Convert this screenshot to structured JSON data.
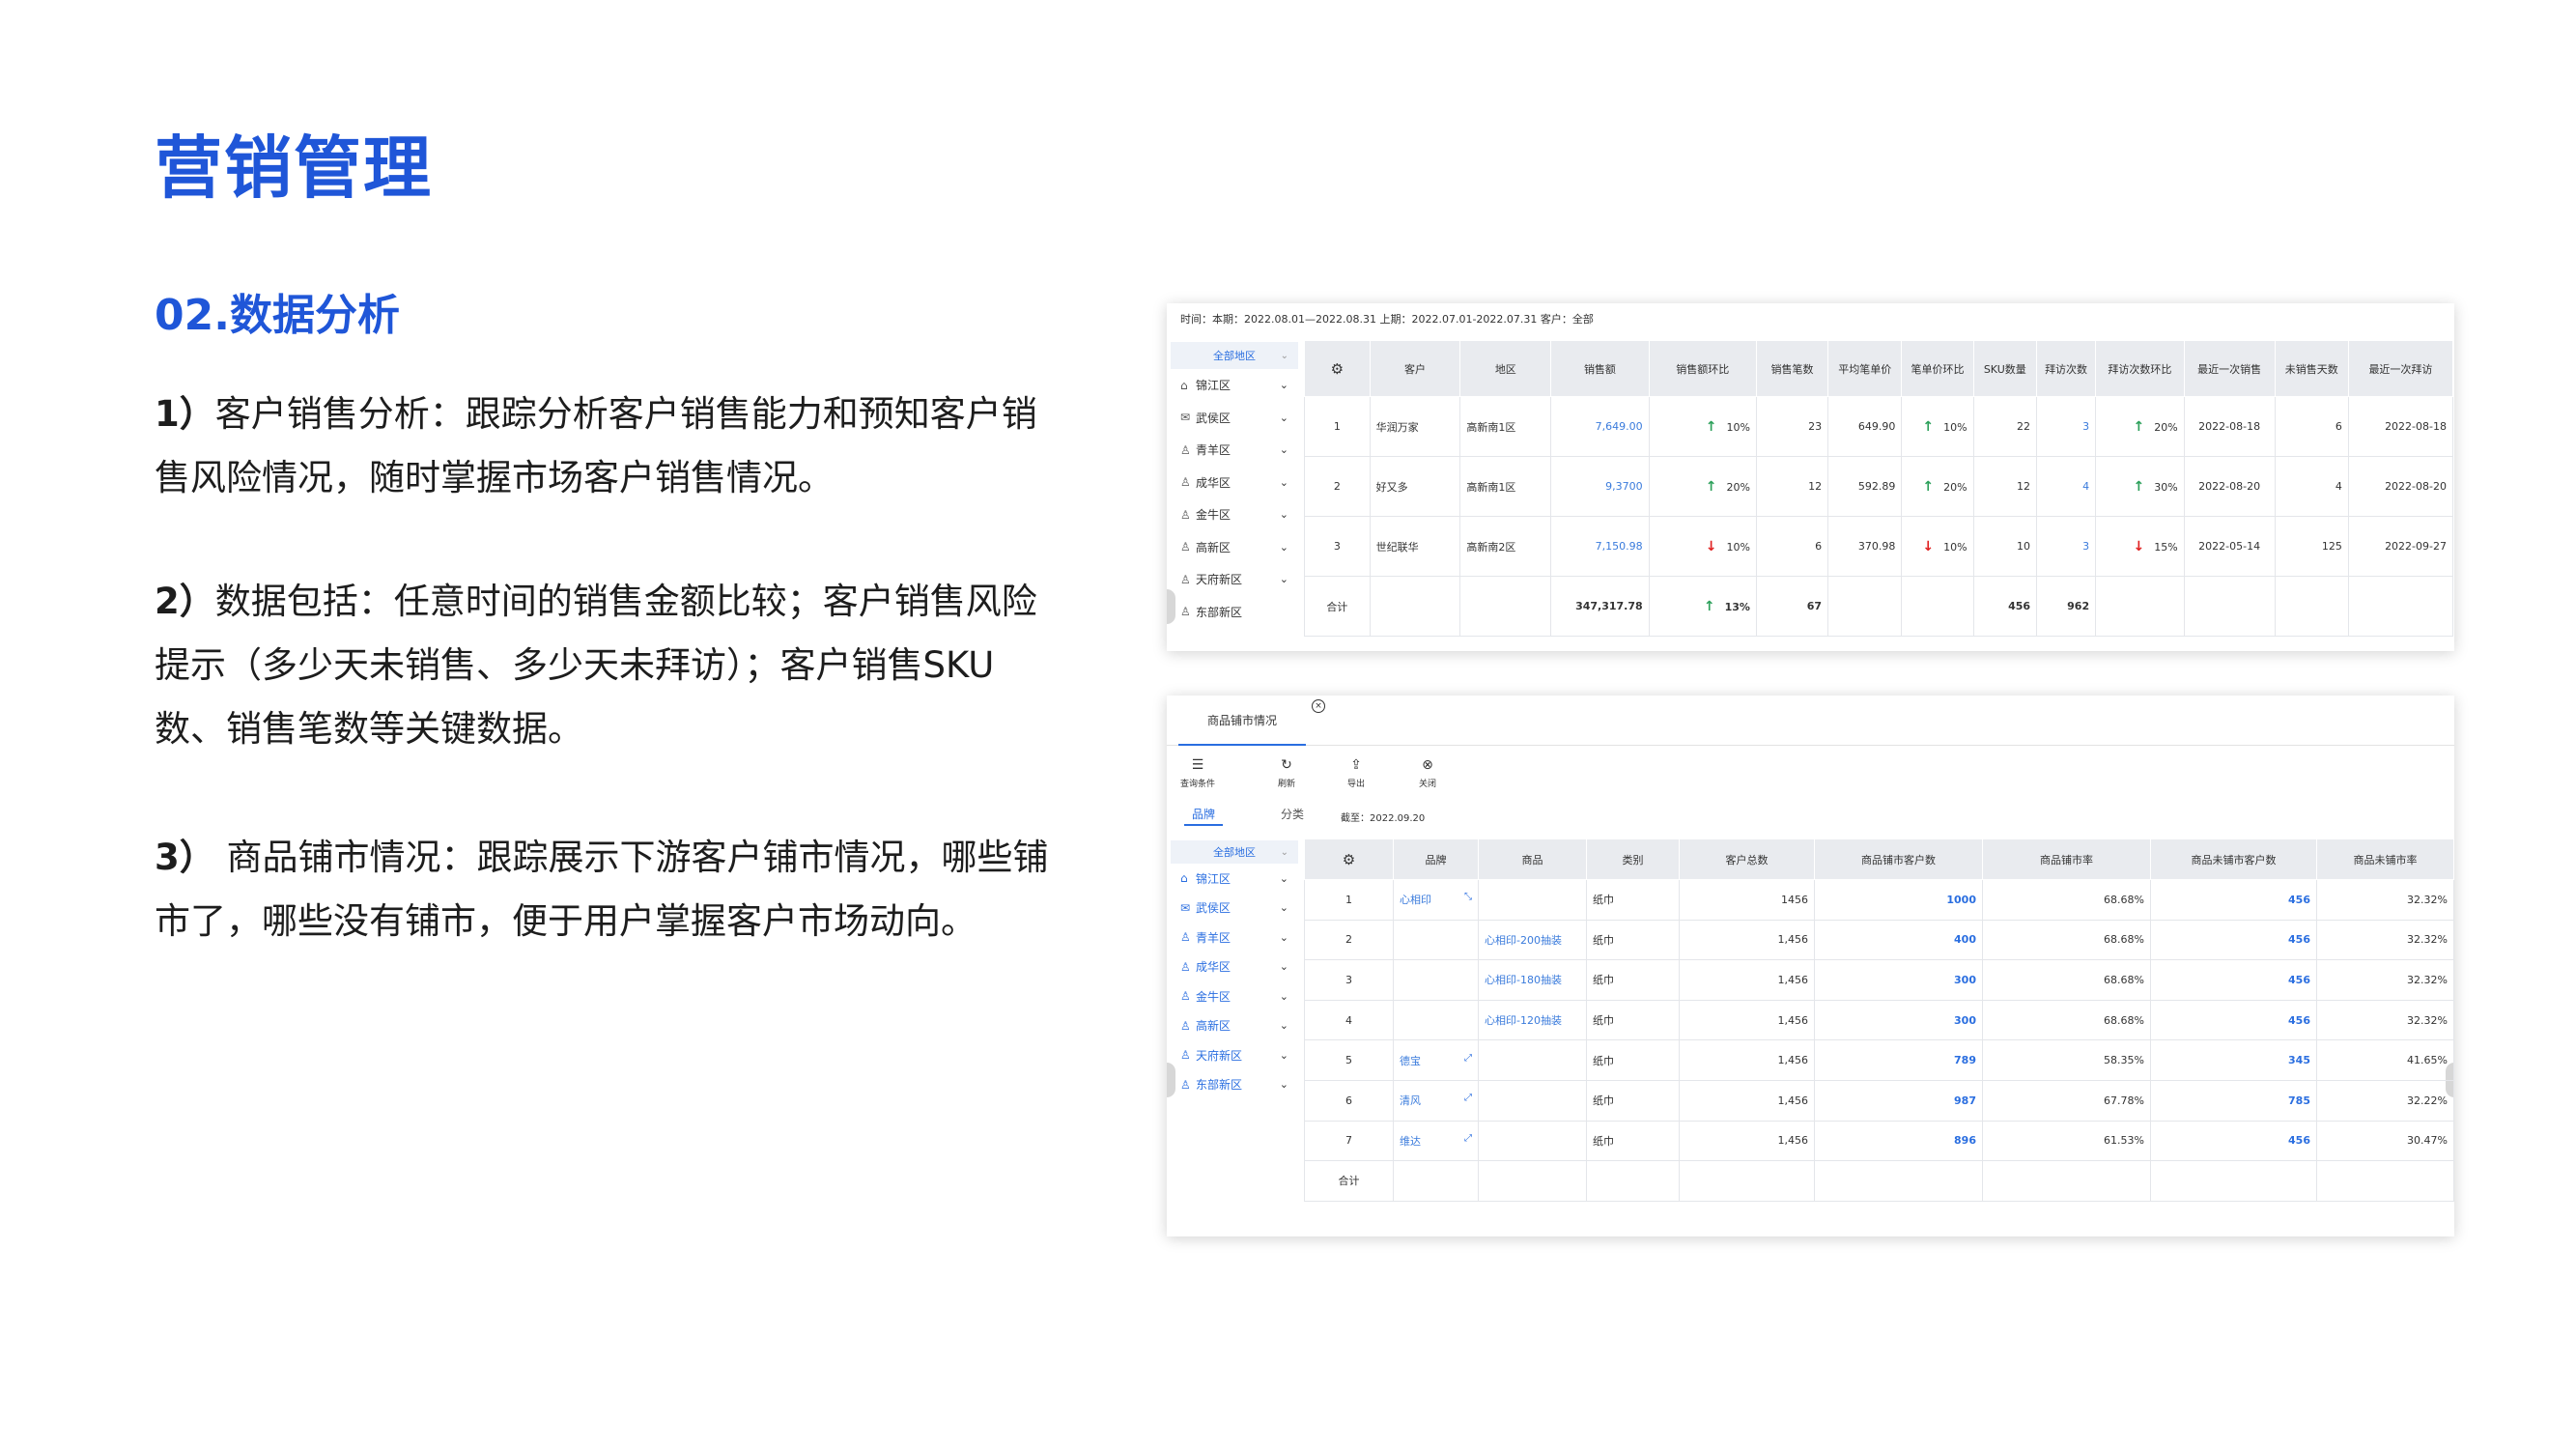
{
  "page": {
    "title": "营销管理",
    "subtitle": "02.数据分析",
    "paragraphs": [
      {
        "num": "1）",
        "text": "客户销售分析：跟踪分析客户销售能力和预知客户销售风险情况，随时掌握市场客户销售情况。"
      },
      {
        "num": "2）",
        "text": "数据包括：任意时间的销售金额比较；客户销售风险提示（多少天未销售、多少天未拜访）；客户销售SKU数、销售笔数等关键数据。"
      },
      {
        "num": "3）",
        "text": " 商品铺市情况：跟踪展示下游客户铺市情况，哪些铺市了，哪些没有铺市，便于用户掌握客户市场动向。"
      }
    ]
  },
  "panel1": {
    "header": "时间：本期：2022.08.01—2022.08.31  上期：2022.07.01-2022.07.31   客户：全部",
    "sidebar": {
      "selected": "全部地区",
      "items": [
        "锦江区",
        "武侯区",
        "青羊区",
        "成华区",
        "金牛区",
        "高新区",
        "天府新区",
        "东部新区"
      ]
    },
    "columns": [
      "客户",
      "地区",
      "销售额",
      "销售额环比",
      "销售笔数",
      "平均笔单价",
      "笔单价环比",
      "SKU数量",
      "拜访次数",
      "拜访次数环比",
      "最近一次销售",
      "未销售天数",
      "最近一次拜访"
    ],
    "rows": [
      {
        "no": "1",
        "customer": "华润万家",
        "region": "高新南1区",
        "sales": "7,649.00",
        "sales_ratio": "10%",
        "sales_dir": "up",
        "count": "23",
        "avg": "649.90",
        "avg_ratio": "10%",
        "avg_dir": "up",
        "sku": "22",
        "visits": "3",
        "visit_ratio": "20%",
        "visit_dir": "up",
        "last_sale": "2022-08-18",
        "unsold_days": "6",
        "last_visit": "2022-08-18"
      },
      {
        "no": "2",
        "customer": "好又多",
        "region": "高新南1区",
        "sales": "9,3700",
        "sales_ratio": "20%",
        "sales_dir": "up",
        "count": "12",
        "avg": "592.89",
        "avg_ratio": "20%",
        "avg_dir": "up",
        "sku": "12",
        "visits": "4",
        "visit_ratio": "30%",
        "visit_dir": "up",
        "last_sale": "2022-08-20",
        "unsold_days": "4",
        "last_visit": "2022-08-20"
      },
      {
        "no": "3",
        "customer": "世纪联华",
        "region": "高新南2区",
        "sales": "7,150.98",
        "sales_ratio": "10%",
        "sales_dir": "down",
        "count": "6",
        "avg": "370.98",
        "avg_ratio": "10%",
        "avg_dir": "down",
        "sku": "10",
        "visits": "3",
        "visit_ratio": "15%",
        "visit_dir": "down",
        "last_sale": "2022-05-14",
        "unsold_days": "125",
        "last_visit": "2022-09-27"
      }
    ],
    "total": {
      "label": "合计",
      "sales": "347,317.78",
      "sales_ratio": "13%",
      "count": "67",
      "sku": "456",
      "visits": "962"
    }
  },
  "panel2": {
    "tab_label": "商品铺市情况",
    "tools": [
      "查询条件",
      "刷新",
      "导出",
      "关闭"
    ],
    "subtabs": [
      "品牌",
      "分类"
    ],
    "cutoff": "截至：2022.09.20",
    "sidebar": {
      "selected": "全部地区",
      "items": [
        "锦江区",
        "武侯区",
        "青羊区",
        "成华区",
        "金牛区",
        "高新区",
        "天府新区",
        "东部新区"
      ]
    },
    "columns": [
      "品牌",
      "商品",
      "类别",
      "客户总数",
      "商品铺市客户数",
      "商品铺市率",
      "商品未铺市客户数",
      "商品未铺市率"
    ],
    "rows": [
      {
        "no": "1",
        "brand": "心相印",
        "product": "",
        "category": "纸巾",
        "total": "1456",
        "covered": "1000",
        "rate": "68.68%",
        "uncovered": "456",
        "unrate": "32.32%"
      },
      {
        "no": "2",
        "brand": "",
        "product": "心相印-200抽装",
        "category": "纸巾",
        "total": "1,456",
        "covered": "400",
        "rate": "68.68%",
        "uncovered": "456",
        "unrate": "32.32%"
      },
      {
        "no": "3",
        "brand": "",
        "product": "心相印-180抽装",
        "category": "纸巾",
        "total": "1,456",
        "covered": "300",
        "rate": "68.68%",
        "uncovered": "456",
        "unrate": "32.32%"
      },
      {
        "no": "4",
        "brand": "",
        "product": "心相印-120抽装",
        "category": "纸巾",
        "total": "1,456",
        "covered": "300",
        "rate": "68.68%",
        "uncovered": "456",
        "unrate": "32.32%"
      },
      {
        "no": "5",
        "brand": "德宝",
        "product": "",
        "category": "纸巾",
        "total": "1,456",
        "covered": "789",
        "rate": "58.35%",
        "uncovered": "345",
        "unrate": "41.65%"
      },
      {
        "no": "6",
        "brand": "清风",
        "product": "",
        "category": "纸巾",
        "total": "1,456",
        "covered": "987",
        "rate": "67.78%",
        "uncovered": "785",
        "unrate": "32.22%"
      },
      {
        "no": "7",
        "brand": "维达",
        "product": "",
        "category": "纸巾",
        "total": "1,456",
        "covered": "896",
        "rate": "61.53%",
        "uncovered": "456",
        "unrate": "30.47%"
      }
    ],
    "total_label": "合计"
  }
}
